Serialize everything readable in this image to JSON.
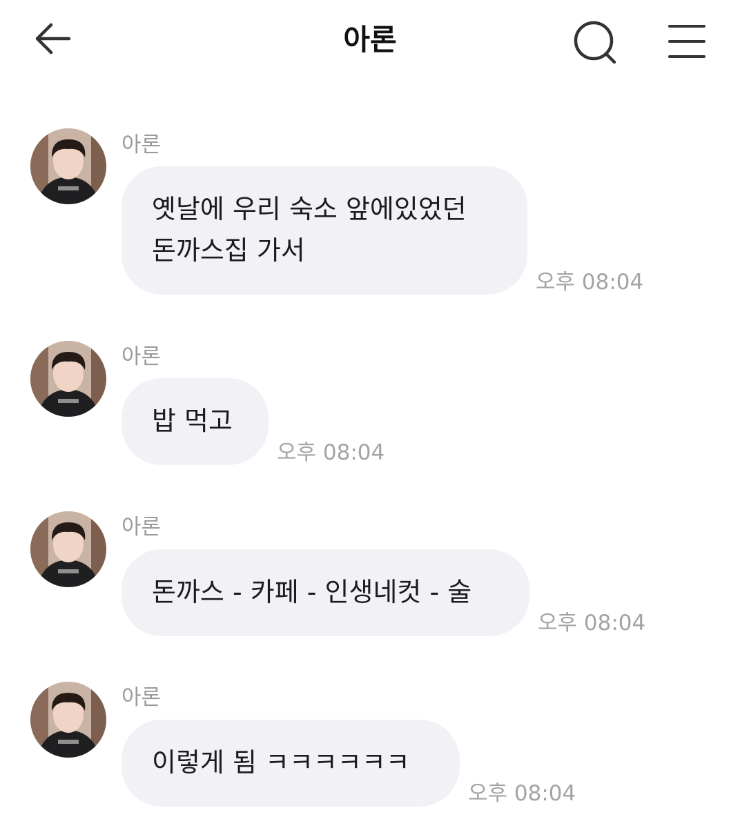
{
  "header": {
    "title": "아론",
    "back_icon": "arrow-left-icon",
    "search_icon": "search-icon",
    "menu_icon": "hamburger-menu-icon"
  },
  "messages": [
    {
      "sender": "아론",
      "text": "옛날에 우리 숙소 앞에있었던\n돈까스집 가서",
      "time": "오후 08:04"
    },
    {
      "sender": "아론",
      "text": "밥 먹고",
      "time": "오후 08:04"
    },
    {
      "sender": "아론",
      "text": "돈까스 - 카페 - 인생네컷 - 술",
      "time": "오후 08:04"
    },
    {
      "sender": "아론",
      "text": "이렇게 됨 ㅋㅋㅋㅋㅋㅋ",
      "time": "오후 08:04"
    }
  ],
  "colors": {
    "bubble": "#f2f2f6",
    "muted_text": "#9a9a9f",
    "icon": "#333333"
  }
}
